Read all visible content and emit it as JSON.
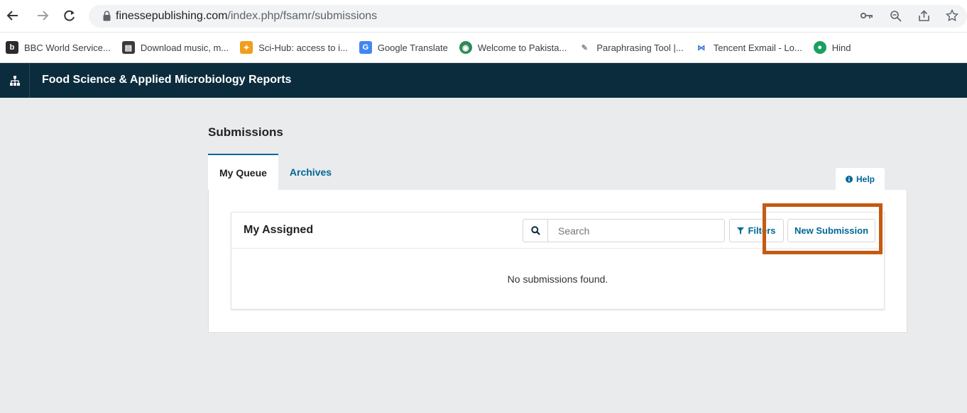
{
  "browser": {
    "url_domain": "finessepublishing.com",
    "url_path": "/index.php/fsamr/submissions",
    "bookmarks": [
      {
        "label": "BBC World Service...",
        "icon": "bbc-icon",
        "color": "#2c2c2c"
      },
      {
        "label": "Download music, m...",
        "icon": "download-icon",
        "color": "#3a3a3a"
      },
      {
        "label": "Sci-Hub: access to i...",
        "icon": "scihub-icon",
        "color": "#f29d1b"
      },
      {
        "label": "Google Translate",
        "icon": "translate-icon",
        "color": "#4285f4"
      },
      {
        "label": "Welcome to Pakista...",
        "icon": "globe-icon",
        "color": "#2e8b57"
      },
      {
        "label": "Paraphrasing Tool |...",
        "icon": "feather-icon",
        "color": "#888888"
      },
      {
        "label": "Tencent Exmail - Lo...",
        "icon": "mail-icon",
        "color": "#2a6fdb"
      },
      {
        "label": "Hind",
        "icon": "hind-icon",
        "color": "#1aa05e"
      }
    ]
  },
  "app": {
    "journal_title": "Food Science & Applied Microbiology Reports",
    "header_color": "#0b2c3d"
  },
  "page": {
    "title": "Submissions",
    "tabs": [
      {
        "label": "My Queue",
        "active": true
      },
      {
        "label": "Archives",
        "active": false
      }
    ],
    "help_label": "Help"
  },
  "card": {
    "title": "My Assigned",
    "search_placeholder": "Search",
    "filters_label": "Filters",
    "new_submission_label": "New Submission",
    "empty_message": "No submissions found."
  },
  "colors": {
    "accent": "#006798",
    "highlight": "#c55a11"
  }
}
